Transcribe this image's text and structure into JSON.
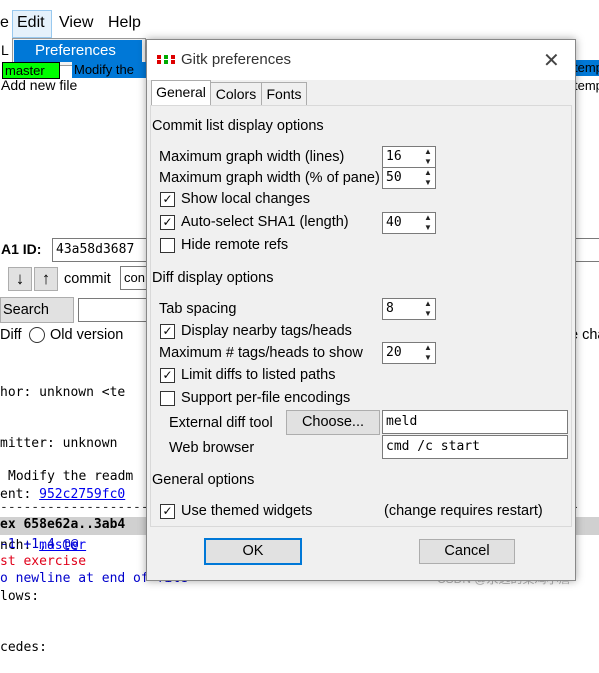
{
  "gitk": {
    "menu": [
      "e",
      "Edit",
      "View",
      "Help"
    ],
    "popup_item": "Preferences",
    "branch_tag": "master",
    "commit_summary": "Modify the",
    "right_clip_1": "temp",
    "right_clip_2": "temp",
    "list_line": "Add new file",
    "left_L": "L",
    "sha_label": "A1 ID:",
    "sha_value": "43a58d3687",
    "commit_label": "commit",
    "commit_field": "con",
    "search_button": "Search",
    "diff_label": "Diff",
    "old_version": "Old version",
    "right_clip_3": "e cha",
    "details": [
      "hor: unknown <te",
      "mitter: unknown ",
      "ent: ",
      "nch: ",
      "lows:",
      "cedes:"
    ],
    "parent_link": "952c2759fc0",
    "branch_link": "master",
    "modify_line": "Modify the readm",
    "dashes": "--------------------------------------------------------------------------",
    "index_line": "ex 658e62a..3ab4",
    "hunk_line": "-1 +1,4 @@",
    "red_line": "st exercise",
    "blue_line": "o newline at end of file"
  },
  "dialog": {
    "title": "Gitk preferences",
    "tabs": [
      "General",
      "Colors",
      "Fonts"
    ],
    "commit_section": "Commit list display options",
    "max_graph_width_lines_label": "Maximum graph width (lines)",
    "max_graph_width_lines_value": "16",
    "max_graph_width_pct_label": "Maximum graph width (% of pane)",
    "max_graph_width_pct_value": "50",
    "show_local_changes_label": "Show local changes",
    "show_local_changes_checked": true,
    "auto_select_sha1_label": "Auto-select SHA1 (length)",
    "auto_select_sha1_checked": true,
    "auto_select_sha1_value": "40",
    "hide_remote_refs_label": "Hide remote refs",
    "hide_remote_refs_checked": false,
    "diff_section": "Diff display options",
    "tab_spacing_label": "Tab spacing",
    "tab_spacing_value": "8",
    "display_nearby_tags_label": "Display nearby tags/heads",
    "display_nearby_tags_checked": true,
    "max_tags_label": "Maximum # tags/heads to show",
    "max_tags_value": "20",
    "limit_diffs_label": "Limit diffs to listed paths",
    "limit_diffs_checked": true,
    "per_file_encodings_label": "Support per-file encodings",
    "per_file_encodings_checked": false,
    "external_diff_label": "External diff tool",
    "choose_button": "Choose...",
    "external_diff_value": "meld",
    "web_browser_label": "Web browser",
    "web_browser_value": "cmd /c start",
    "general_section": "General options",
    "themed_widgets_label": "Use themed widgets",
    "themed_widgets_checked": true,
    "restart_note": "(change requires restart)",
    "ok_button": "OK",
    "cancel_button": "Cancel"
  },
  "watermark": "CSDN @永远的菜鸡小詹",
  "colors": {
    "accent": "#0078d7",
    "branch_green": "#00ff00",
    "diff_red": "#e0001a"
  }
}
